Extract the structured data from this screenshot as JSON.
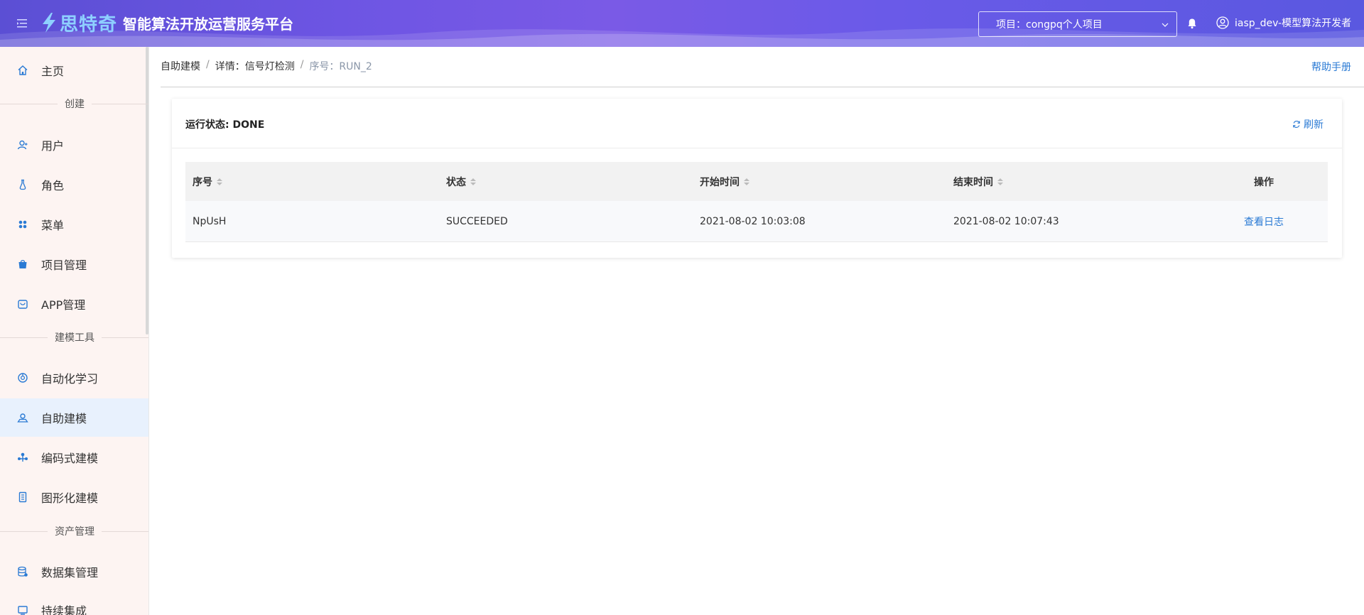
{
  "header": {
    "brand": "思特奇",
    "platform_title": "智能算法开放运营服务平台",
    "project_select": "项目：congpq个人项目",
    "user": "iasp_dev-模型算法开发者"
  },
  "sidebar": {
    "items": [
      {
        "label": "主页",
        "icon": "home-icon"
      },
      {
        "group": "创建"
      },
      {
        "label": "用户",
        "icon": "user-icon"
      },
      {
        "label": "角色",
        "icon": "role-icon"
      },
      {
        "label": "菜单",
        "icon": "menu-icon"
      },
      {
        "label": "项目管理",
        "icon": "project-icon"
      },
      {
        "label": "APP管理",
        "icon": "app-icon"
      },
      {
        "group": "建模工具"
      },
      {
        "label": "自动化学习",
        "icon": "automl-icon"
      },
      {
        "label": "自助建模",
        "icon": "self-modeling-icon",
        "active": true
      },
      {
        "label": "编码式建模",
        "icon": "code-modeling-icon"
      },
      {
        "label": "图形化建模",
        "icon": "graph-modeling-icon"
      },
      {
        "group": "资产管理"
      },
      {
        "label": "数据集管理",
        "icon": "dataset-icon"
      },
      {
        "label": "持续集成",
        "icon": "ci-icon"
      }
    ]
  },
  "breadcrumb": {
    "items": [
      "自助建模",
      "详情：信号灯检测",
      "序号：RUN_2"
    ]
  },
  "help_link": "帮助手册",
  "card": {
    "title": "运行状态: DONE",
    "refresh": "刷新"
  },
  "table": {
    "columns": [
      "序号",
      "状态",
      "开始时间",
      "结束时间",
      "操作"
    ],
    "rows": [
      {
        "id": "NpUsH",
        "status": "SUCCEEDED",
        "start": "2021-08-02 10:03:08",
        "end": "2021-08-02 10:07:43",
        "action": "查看日志"
      }
    ]
  },
  "colors": {
    "accent": "#2a7ad4",
    "header_start": "#5b4fd4",
    "header_mid": "#7a5ae6",
    "sidebar_bg": "#fdf4f2",
    "active_bg": "#e8f1fd"
  }
}
